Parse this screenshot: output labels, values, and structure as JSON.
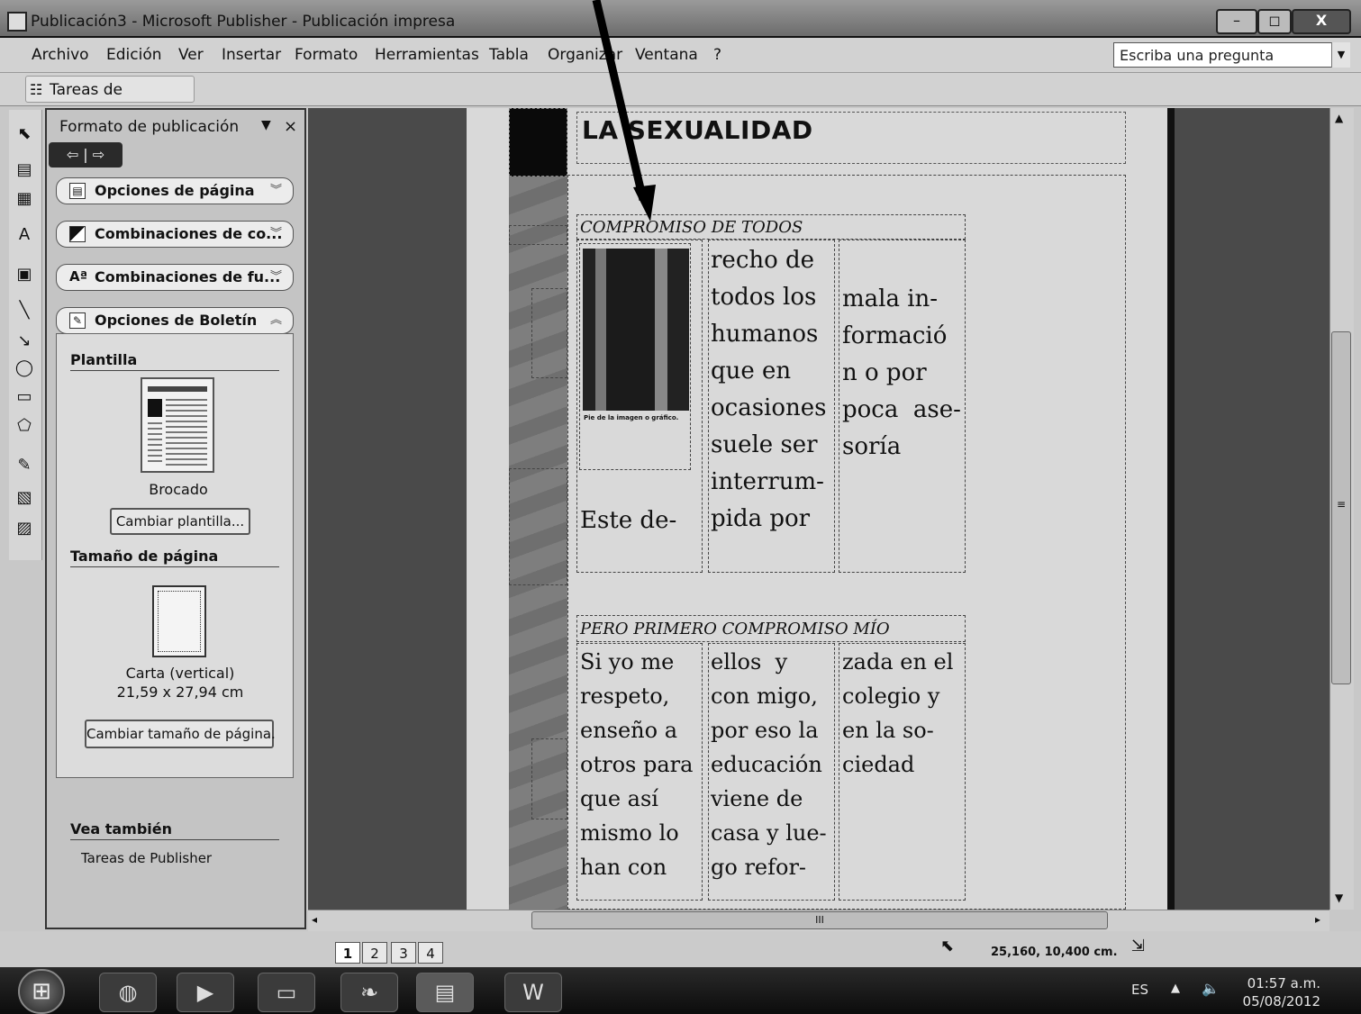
{
  "window": {
    "title": "Publicación3 - Microsoft Publisher - Publicación impresa",
    "minimize": "–",
    "maximize": "◻",
    "close": "X"
  },
  "menu": {
    "items": [
      "Archivo",
      "Edición",
      "Ver",
      "Insertar",
      "Formato",
      "Herramientas",
      "Tabla",
      "Organizar",
      "Ventana",
      "?"
    ],
    "ask_placeholder": "Escriba una pregunta"
  },
  "toolbar": {
    "tasks_button": "Tareas de Publisher"
  },
  "task_pane": {
    "title": "Formato de publicación",
    "sections": [
      {
        "label": "Opciones de página",
        "icon": "page-options-icon"
      },
      {
        "label": "Combinaciones de co...",
        "icon": "color-scheme-icon"
      },
      {
        "label": "Combinaciones de fu...",
        "icon": "font-scheme-icon"
      },
      {
        "label": "Opciones de Boletín",
        "icon": "newsletter-options-icon"
      }
    ],
    "template_heading": "Plantilla",
    "template_name": "Brocado",
    "change_template": "Cambiar plantilla...",
    "page_size_heading": "Tamaño de página",
    "page_size_name": "Carta (vertical)",
    "page_size_dims": "21,59 x 27,94 cm",
    "change_page_size": "Cambiar tamaño de página.",
    "see_also_heading": "Vea también",
    "see_also_link": "Tareas de Publisher"
  },
  "document": {
    "headline": "LA SEXUALIDAD",
    "article1": {
      "heading": "COMPROMISO DE TODOS",
      "photo_caption": "Pie de la imagen o gráfico.",
      "col1": "Este de-",
      "col2": "recho de\ntodos los\nhumanos\nque en\nocasiones\nsuele ser\ninterrum-\npida por",
      "col3": "mala in-\nformació\nn o por\npoca  ase-\nsoría"
    },
    "article2": {
      "heading": "PERO PRIMERO COMPROMISO MÍO",
      "col1": "Si yo me\nrespeto,\nenseño a\notros para\nque así\nmismo lo\nhan con",
      "col2": "ellos  y\ncon migo,\npor eso la\neducación\nviene de\ncasa y lue-\ngo refor-",
      "col3": "zada en el\ncolegio y\nen la so-\nciedad"
    }
  },
  "status": {
    "pages": [
      "1",
      "2",
      "3",
      "4"
    ],
    "active_page": "1",
    "coordinates": "25,160, 10,400 cm.",
    "hscroll_grip": "III"
  },
  "taskbar": {
    "language": "ES",
    "time": "01:57 a.m.",
    "date": "05/08/2012"
  }
}
